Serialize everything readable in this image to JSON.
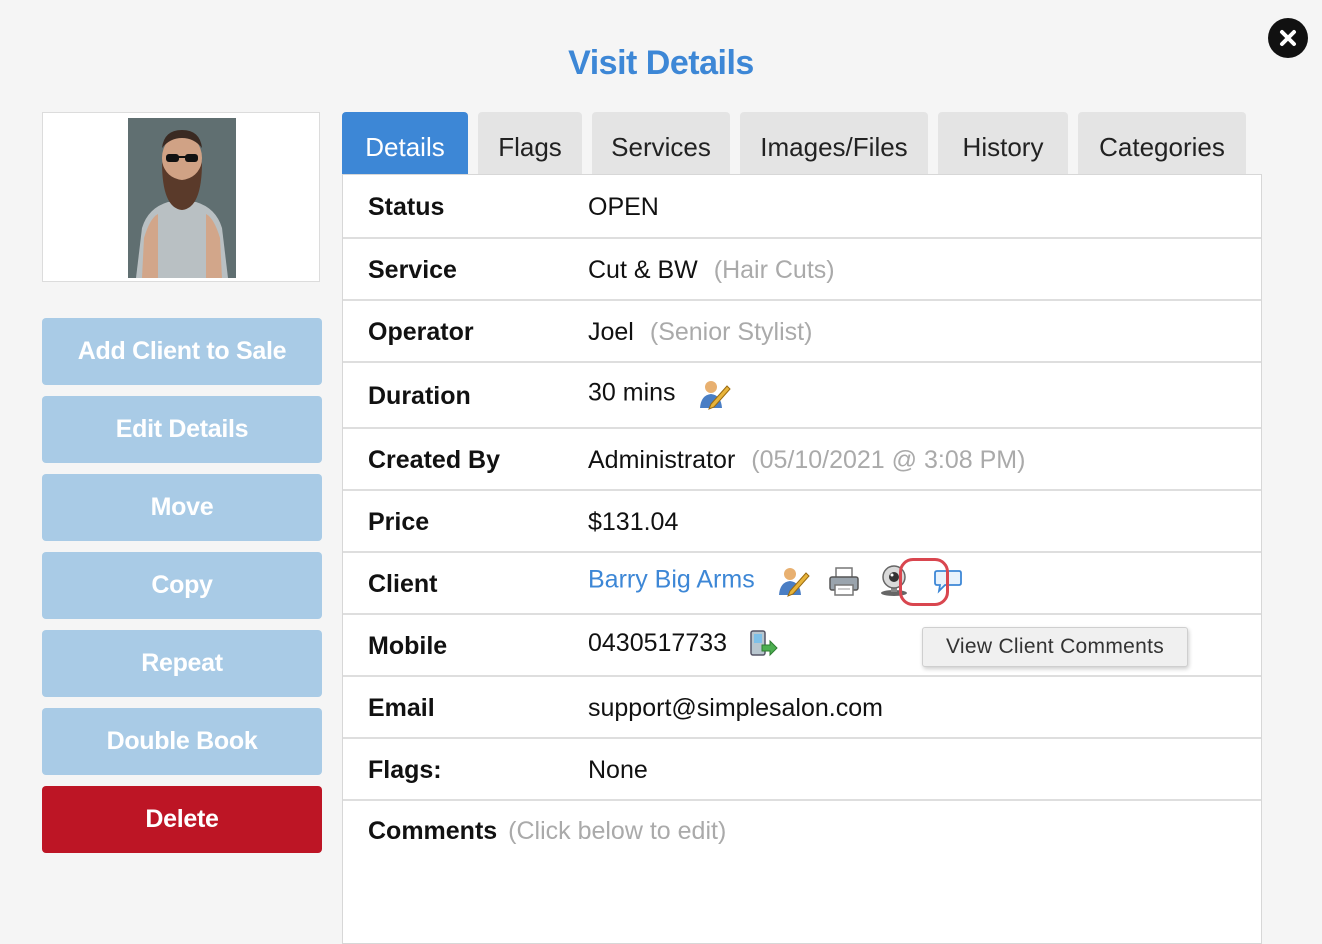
{
  "dialog": {
    "title": "Visit Details",
    "close_icon": "close-icon"
  },
  "sidebar": {
    "buttons": [
      {
        "label": "Add Client to Sale"
      },
      {
        "label": "Edit Details"
      },
      {
        "label": "Move"
      },
      {
        "label": "Copy"
      },
      {
        "label": "Repeat"
      },
      {
        "label": "Double Book"
      },
      {
        "label": "Delete"
      }
    ]
  },
  "tabs": [
    {
      "label": "Details",
      "active": true
    },
    {
      "label": "Flags"
    },
    {
      "label": "Services"
    },
    {
      "label": "Images/Files"
    },
    {
      "label": "History"
    },
    {
      "label": "Categories"
    }
  ],
  "details": {
    "status": {
      "label": "Status",
      "value": "OPEN"
    },
    "service": {
      "label": "Service",
      "value": "Cut & BW",
      "sub": "(Hair Cuts)"
    },
    "operator": {
      "label": "Operator",
      "value": "Joel",
      "sub": "(Senior Stylist)"
    },
    "duration": {
      "label": "Duration",
      "value": "30 mins"
    },
    "created_by": {
      "label": "Created By",
      "value": "Administrator",
      "sub": "(05/10/2021 @ 3:08 PM)"
    },
    "price": {
      "label": "Price",
      "value": "$131.04"
    },
    "client": {
      "label": "Client",
      "value": "Barry Big Arms"
    },
    "mobile": {
      "label": "Mobile",
      "value": "0430517733"
    },
    "email": {
      "label": "Email",
      "value": "support@simplesalon.com"
    },
    "flags": {
      "label": "Flags:",
      "value": "None"
    },
    "comments": {
      "label": "Comments",
      "hint": "(Click below to edit)"
    }
  },
  "tooltip": "View Client Comments",
  "colors": {
    "accent": "#3d87d6",
    "button_disabled": "#a9cbe6",
    "danger": "#bd1525",
    "highlight_ring": "#d9464f"
  }
}
